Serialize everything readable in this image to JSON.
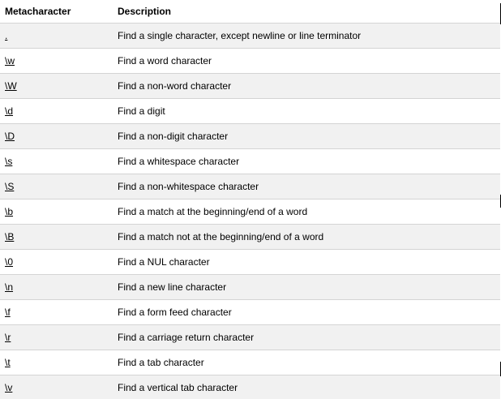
{
  "table": {
    "headers": {
      "metacharacter": "Metacharacter",
      "description": "Description"
    },
    "rows": [
      {
        "meta": ".",
        "description": "Find a single character, except newline or line terminator"
      },
      {
        "meta": "\\w",
        "description": "Find a word character"
      },
      {
        "meta": "\\W",
        "description": "Find a non-word character"
      },
      {
        "meta": "\\d",
        "description": "Find a digit"
      },
      {
        "meta": "\\D",
        "description": "Find a non-digit character"
      },
      {
        "meta": "\\s",
        "description": "Find a whitespace character"
      },
      {
        "meta": "\\S",
        "description": "Find a non-whitespace character"
      },
      {
        "meta": "\\b",
        "description": "Find a match at the beginning/end of a word"
      },
      {
        "meta": "\\B",
        "description": "Find a match not at the beginning/end of a word"
      },
      {
        "meta": "\\0",
        "description": "Find a NUL character"
      },
      {
        "meta": "\\n",
        "description": "Find a new line character"
      },
      {
        "meta": "\\f",
        "description": "Find a form feed character"
      },
      {
        "meta": "\\r",
        "description": "Find a carriage return character"
      },
      {
        "meta": "\\t",
        "description": "Find a tab character"
      },
      {
        "meta": "\\v",
        "description": "Find a vertical tab character"
      }
    ]
  },
  "colors": {
    "row_alt": "#f1f1f1",
    "row_base": "#ffffff",
    "border": "#d4d4d4",
    "text": "#000000"
  }
}
